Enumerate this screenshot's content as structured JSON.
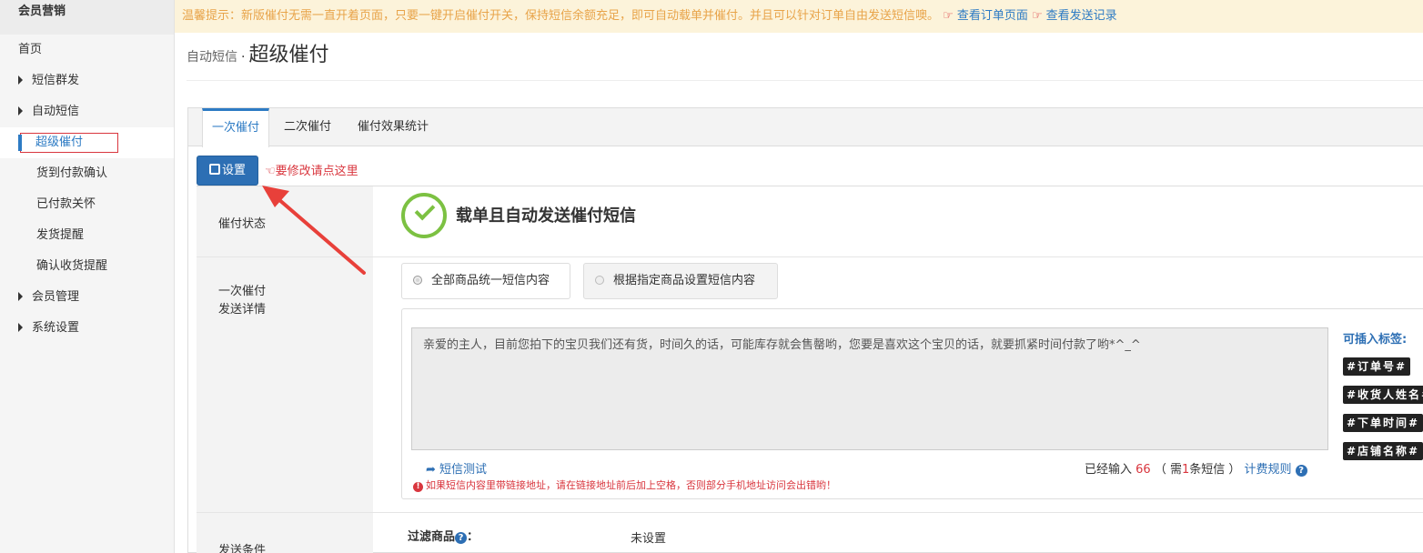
{
  "sidebar": {
    "title": "会员营销",
    "items": [
      {
        "label": "首页"
      },
      {
        "label": "短信群发"
      },
      {
        "label": "自动短信"
      },
      {
        "label": "超级催付"
      },
      {
        "label": "货到付款确认"
      },
      {
        "label": "已付款关怀"
      },
      {
        "label": "发货提醒"
      },
      {
        "label": "确认收货提醒"
      },
      {
        "label": "会员管理"
      },
      {
        "label": "系统设置"
      }
    ]
  },
  "notice": {
    "text": "温馨提示：新版催付无需一直开着页面，只要一键开启催付开关，保持短信余额充足，即可自动载单并催付。并且可以针对订单自由发送短信噢。",
    "link_orders": "查看订单页面",
    "link_records": "查看发送记录",
    "hand_glyph": "☞"
  },
  "header": {
    "crumb": "自动短信",
    "dot": "·",
    "title": "超级催付"
  },
  "tabs": [
    "一次催付",
    "二次催付",
    "催付效果统计"
  ],
  "toolbar": {
    "setting_label": "设置",
    "hint": "要修改请点这里",
    "hint_glyph": "☜"
  },
  "status": {
    "label": "催付状态",
    "text": "载单且自动发送催付短信"
  },
  "detail": {
    "label_line1": "一次催付",
    "label_line2": "发送详情",
    "option_all": "全部商品统一短信内容",
    "option_specific": "根据指定商品设置短信内容",
    "message": "亲爱的主人，目前您拍下的宝贝我们还有货，时间久的话，可能库存就会售罄哟，您要是喜欢这个宝贝的话，就要抓紧时间付款了哟*^_^",
    "tags_title": "可插入标签:",
    "tags": [
      "#订单号#",
      "#收货人姓名#",
      "#下单时间#",
      "#店铺名称#"
    ],
    "sms_test": "短信测试",
    "count_prefix": "已经输入",
    "count_value": "66",
    "count_mid1": "（ 需",
    "count_sms": "1",
    "count_mid2": "条短信 ）",
    "fee_rule": "计费规则",
    "warning": "如果短信内容里带链接地址，请在链接地址前后加上空格，否则部分手机地址访问会出错哟！"
  },
  "condition": {
    "label": "发送条件",
    "filter_label": "过滤商品",
    "filter_suffix": "：",
    "filter_value": "未设置"
  },
  "colors": {
    "accent": "#2d6fb4",
    "success": "#7cc142",
    "danger": "#d9363e",
    "notice_bg": "#fcf3da"
  }
}
